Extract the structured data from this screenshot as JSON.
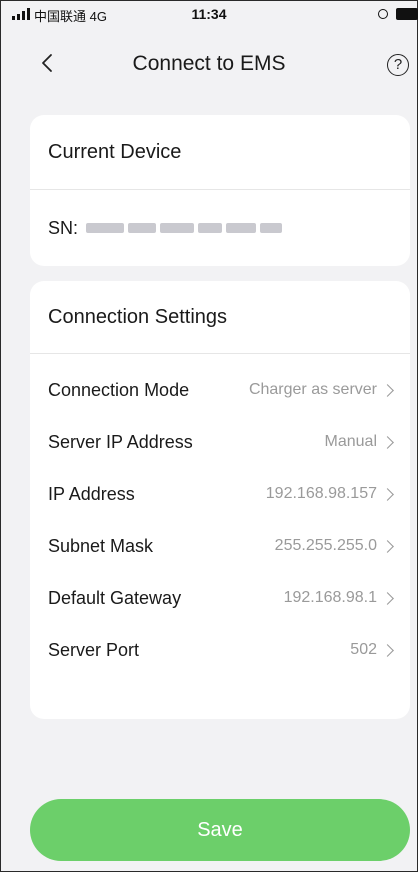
{
  "status_bar": {
    "carrier": "中国联通 4G",
    "time": "11:34"
  },
  "nav": {
    "title": "Connect to EMS",
    "back_icon": "chevron-left-icon",
    "help_label": "?",
    "help_icon": "question-circle-icon"
  },
  "device": {
    "header": "Current Device",
    "sn_label": "SN:"
  },
  "settings": {
    "header": "Connection Settings",
    "rows": [
      {
        "label": "Connection Mode",
        "value": "Charger as server"
      },
      {
        "label": "Server IP Address",
        "value": "Manual"
      },
      {
        "label": "IP Address",
        "value": "192.168.98.157"
      },
      {
        "label": "Subnet Mask",
        "value": "255.255.255.0"
      },
      {
        "label": "Default Gateway",
        "value": "192.168.98.1"
      },
      {
        "label": "Server Port",
        "value": "502"
      }
    ]
  },
  "actions": {
    "save_label": "Save",
    "save_color": "#6ccf6a"
  }
}
